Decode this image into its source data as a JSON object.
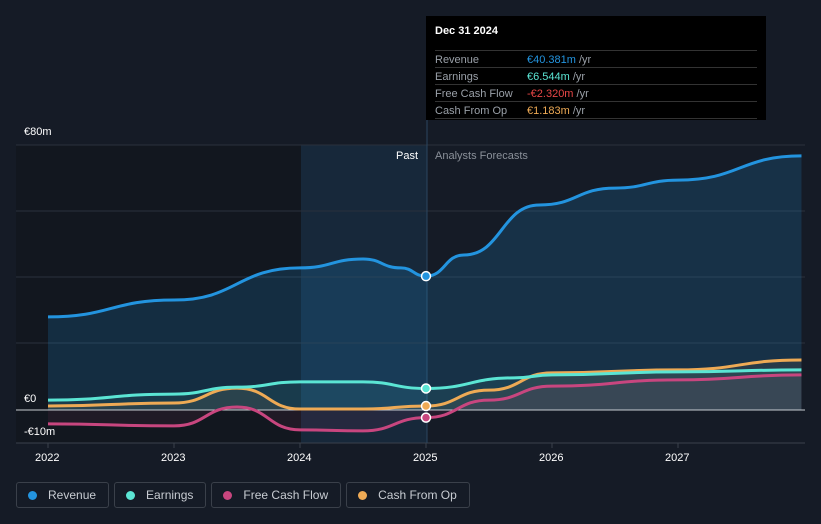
{
  "tooltip": {
    "date": "Dec 31 2024",
    "rows": [
      {
        "label": "Revenue",
        "value": "€40.381m",
        "unit": " /yr",
        "color": "#2394df"
      },
      {
        "label": "Earnings",
        "value": "€6.544m",
        "unit": " /yr",
        "color": "#5be5d4"
      },
      {
        "label": "Free Cash Flow",
        "value": "-€2.320m",
        "unit": " /yr",
        "color": "#e64646"
      },
      {
        "label": "Cash From Op",
        "value": "€1.183m",
        "unit": " /yr",
        "color": "#eeaa55"
      }
    ]
  },
  "labels": {
    "past": "Past",
    "forecast": "Analysts Forecasts"
  },
  "chart_data": {
    "type": "line",
    "y_ticks": [
      "€80m",
      "€0",
      "-€10m"
    ],
    "x_ticks": [
      "2022",
      "2023",
      "2024",
      "2025",
      "2026",
      "2027"
    ],
    "ylim": [
      -10,
      80
    ],
    "divider_x": 2025.0,
    "series": [
      {
        "name": "Revenue",
        "color": "#2394df",
        "x": [
          2022,
          2023,
          2024,
          2024.5,
          2024.8,
          2025,
          2025.3,
          2025.9,
          2026.5,
          2027,
          2027.98
        ],
        "y": [
          28.1,
          33.2,
          42.9,
          45.6,
          42.9,
          40.4,
          46.8,
          61.9,
          67,
          69.4,
          76.7
        ]
      },
      {
        "name": "Earnings",
        "color": "#5be5d4",
        "x": [
          2022,
          2023,
          2023.5,
          2024,
          2024.5,
          2025,
          2025.7,
          2026,
          2027,
          2027.98
        ],
        "y": [
          3.0,
          4.8,
          6.9,
          8.5,
          8.5,
          6.5,
          9.7,
          10.6,
          11.5,
          12.1
        ]
      },
      {
        "name": "Free Cash Flow",
        "color": "#c8467f",
        "x": [
          2022,
          2023,
          2023.5,
          2024,
          2024.5,
          2025,
          2025.5,
          2026,
          2027,
          2027.98
        ],
        "y": [
          -4.2,
          -4.8,
          0.9,
          -6,
          -6.3,
          -2.3,
          3,
          7.2,
          9.1,
          10.6
        ]
      },
      {
        "name": "Cash From Op",
        "color": "#eeaa55",
        "x": [
          2022,
          2023,
          2023.5,
          2024,
          2024.5,
          2025,
          2025.5,
          2026,
          2027,
          2027.98
        ],
        "y": [
          1.2,
          2.1,
          6.6,
          0.3,
          0.3,
          1.2,
          6,
          11.2,
          12.1,
          15.1
        ]
      }
    ]
  }
}
